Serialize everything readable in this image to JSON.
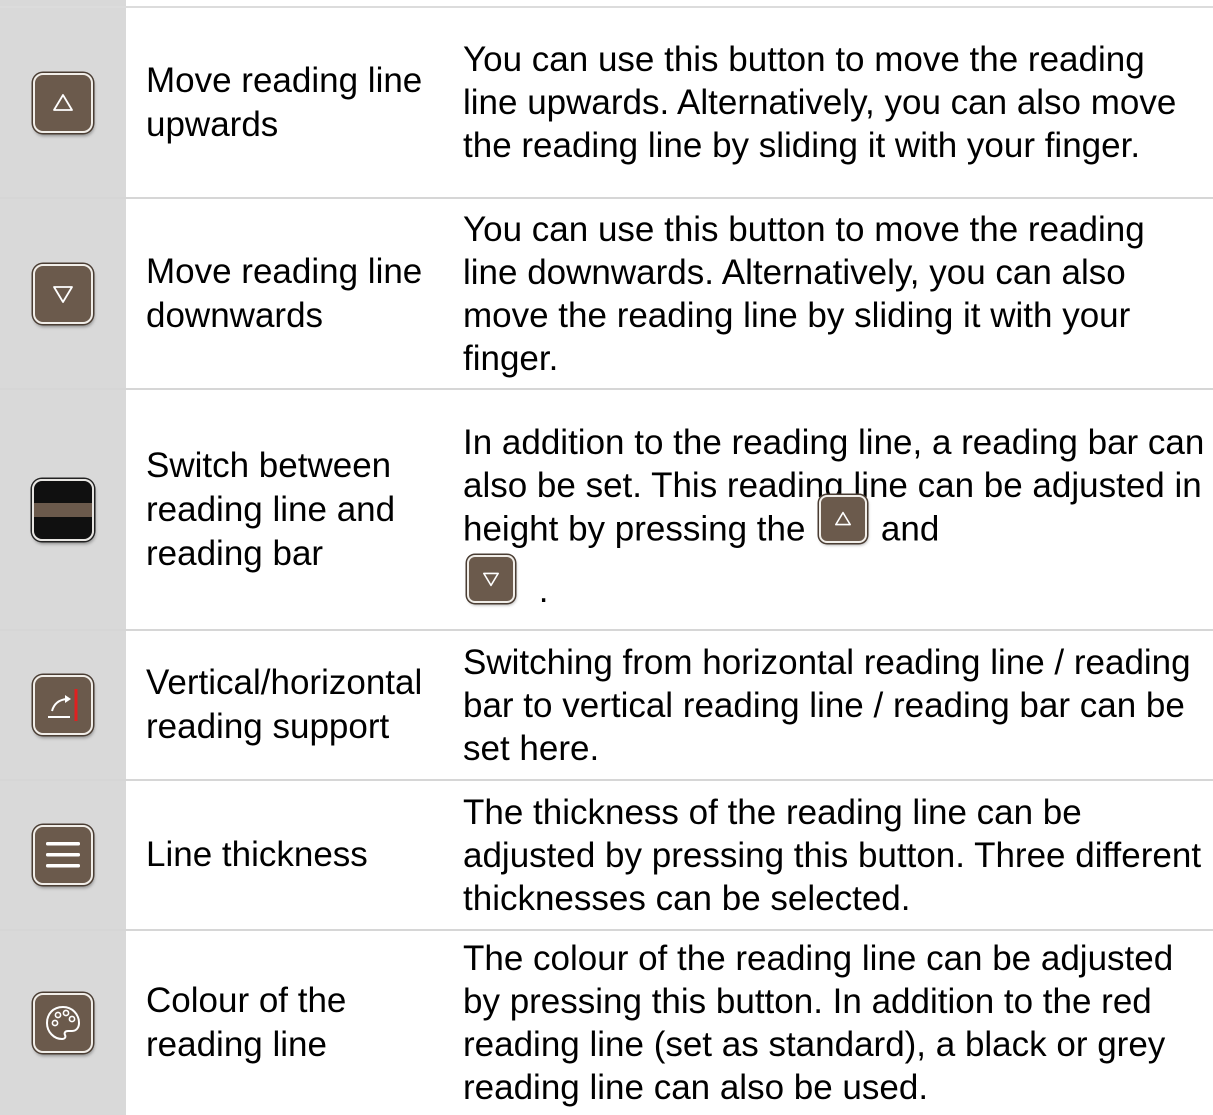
{
  "rows": [
    {
      "icon": "arrow-up-icon",
      "name": "Move reading line upwards",
      "description": "You can use this button to move the reading line upwards. Alternatively, you can also move the reading line by sliding it with your finger."
    },
    {
      "icon": "arrow-down-icon",
      "name": "Move reading line downwards",
      "description": "You can use this button to move the reading line downwards. Alternatively, you can also move the reading line by sliding it with your finger."
    },
    {
      "icon": "reading-bar-icon",
      "name": "Switch between reading line and reading bar",
      "description_parts": [
        "In addition to the reading line, a reading bar can also be set. This reading line can be adjusted in height by pressing the",
        "and",
        "."
      ]
    },
    {
      "icon": "rotate-orientation-icon",
      "name": "Vertical/horizontal reading support",
      "description": "Switching from horizontal reading line / reading bar to vertical reading line / reading bar can be set here."
    },
    {
      "icon": "menu-lines-icon",
      "name": "Line thickness",
      "description": "The thickness of the reading line can be adjusted by pressing this button. Three different thicknesses can be selected."
    },
    {
      "icon": "palette-icon",
      "name": "Colour of the reading line",
      "description": "The colour of the reading line can be adjusted by pressing this button. In addition to the red reading line (set as standard), a black or grey reading line can also be used."
    }
  ],
  "colors": {
    "button_brown": "#6b5a4c",
    "icon_column_bg": "#d9d9d9",
    "accent_red": "#e02020"
  }
}
